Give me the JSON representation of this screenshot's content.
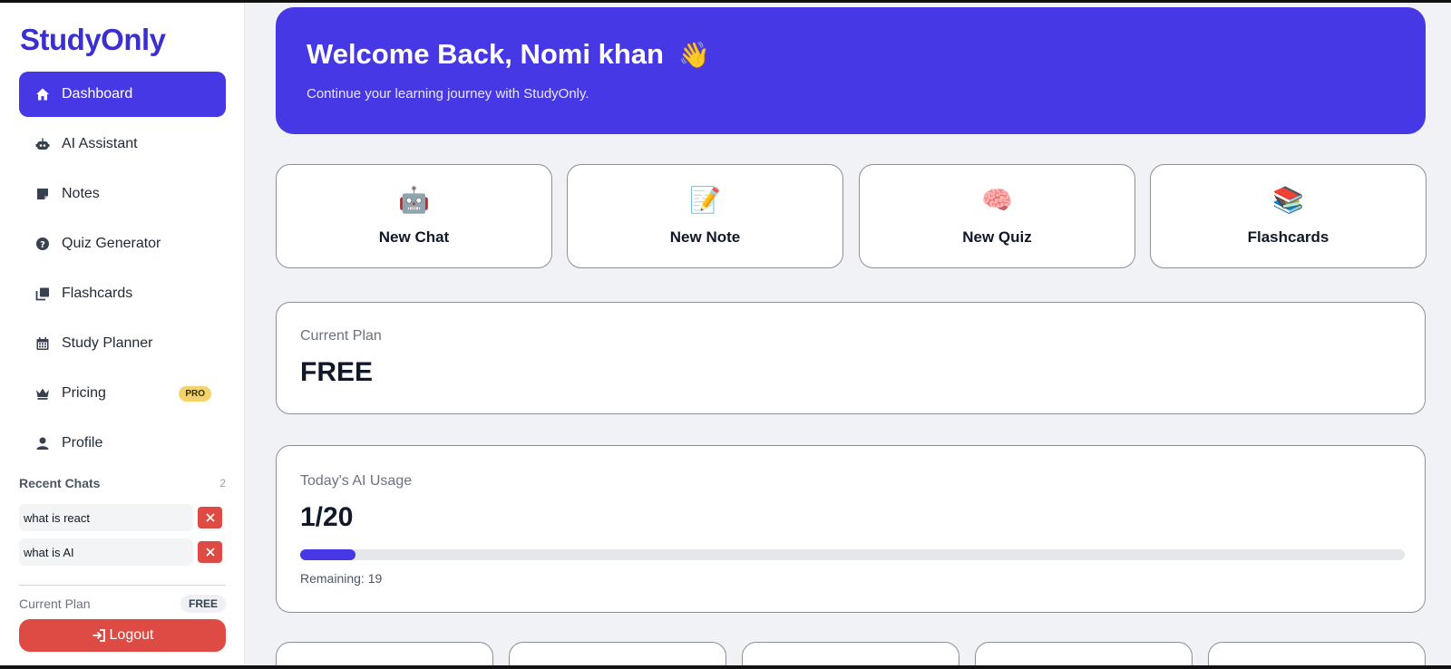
{
  "sidebar": {
    "brand": "StudyOnly",
    "nav": [
      {
        "label": "Dashboard",
        "icon": "home-icon",
        "active": true
      },
      {
        "label": "AI Assistant",
        "icon": "robot-icon"
      },
      {
        "label": "Notes",
        "icon": "note-icon"
      },
      {
        "label": "Quiz Generator",
        "icon": "question-circle-icon"
      },
      {
        "label": "Flashcards",
        "icon": "cards-icon"
      },
      {
        "label": "Study Planner",
        "icon": "calendar-icon"
      },
      {
        "label": "Pricing",
        "icon": "crown-icon",
        "badge": "PRO"
      },
      {
        "label": "Profile",
        "icon": "user-icon"
      }
    ],
    "recent_chats": {
      "title": "Recent Chats",
      "count": "2",
      "items": [
        {
          "label": "what is react"
        },
        {
          "label": "what is AI"
        }
      ]
    },
    "plan_label": "Current Plan",
    "plan_value": "FREE",
    "logout_label": "Logout"
  },
  "hero": {
    "title": "Welcome Back, Nomi khan",
    "emoji": "👋",
    "subtitle": "Continue your learning journey with StudyOnly."
  },
  "quick_actions": [
    {
      "label": "New Chat",
      "emoji": "🤖"
    },
    {
      "label": "New Note",
      "emoji": "📝"
    },
    {
      "label": "New Quiz",
      "emoji": "🧠"
    },
    {
      "label": "Flashcards",
      "emoji": "📚"
    }
  ],
  "plan_card": {
    "label": "Current Plan",
    "value": "FREE"
  },
  "usage_card": {
    "label": "Today's AI Usage",
    "value": "1/20",
    "used": 1,
    "limit": 20,
    "remaining_text": "Remaining: 19"
  },
  "colors": {
    "accent": "#4738e6",
    "danger": "#de4b44",
    "pro_badge": "#f3d36b"
  }
}
